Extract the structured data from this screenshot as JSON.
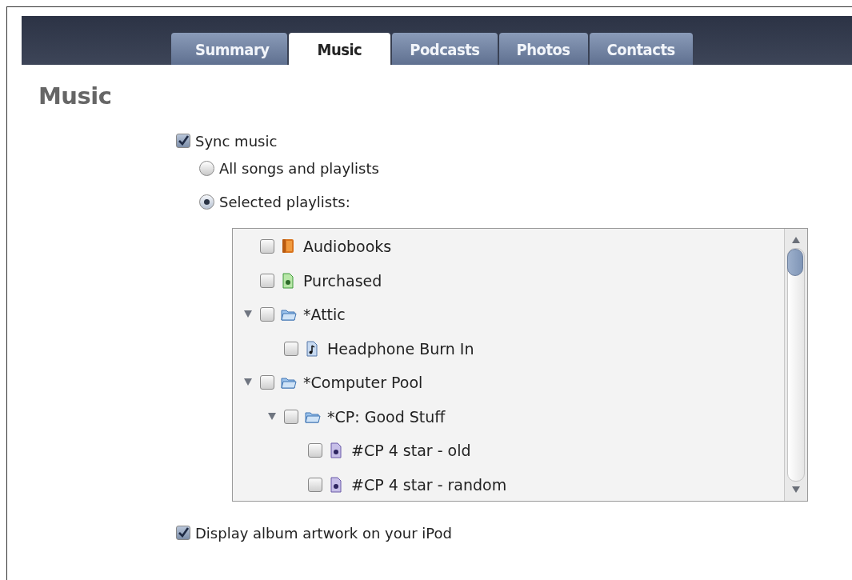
{
  "tabs": [
    {
      "label": "Summary",
      "selected": false
    },
    {
      "label": "Music",
      "selected": true
    },
    {
      "label": "Podcasts",
      "selected": false
    },
    {
      "label": "Photos",
      "selected": false
    },
    {
      "label": "Contacts",
      "selected": false
    }
  ],
  "heading": "Music",
  "sync_music": {
    "label": "Sync music",
    "checked": true
  },
  "sync_options": [
    {
      "label": "All songs and playlists",
      "selected": false
    },
    {
      "label": "Selected playlists:",
      "selected": true
    }
  ],
  "playlists": [
    {
      "label": "Audiobooks",
      "kind": "audiobook",
      "checked": false
    },
    {
      "label": "Purchased",
      "kind": "green-smart",
      "checked": false
    },
    {
      "label": "*Attic",
      "kind": "folder",
      "checked": false,
      "expanded": true,
      "children": [
        {
          "label": "Headphone Burn In",
          "kind": "playlist",
          "checked": false
        }
      ]
    },
    {
      "label": "*Computer Pool",
      "kind": "folder",
      "checked": false,
      "expanded": true,
      "children": [
        {
          "label": "*CP: Good Stuff",
          "kind": "folder",
          "checked": false,
          "expanded": true,
          "children": [
            {
              "label": "#CP 4 star - old",
              "kind": "smart",
              "checked": false
            },
            {
              "label": "#CP 4 star - random",
              "kind": "smart",
              "checked": false
            }
          ]
        }
      ]
    }
  ],
  "display_artwork": {
    "label": "Display album artwork on your iPod",
    "checked": true
  }
}
